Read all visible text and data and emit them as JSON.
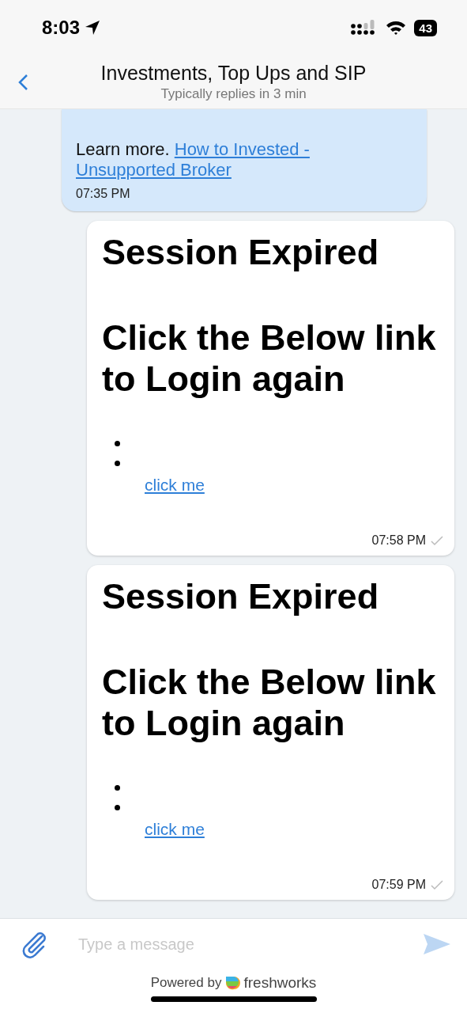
{
  "status_bar": {
    "time": "8:03",
    "battery": "43"
  },
  "header": {
    "title": "Investments, Top Ups and SIP",
    "subtitle": "Typically replies in 3 min"
  },
  "messages": [
    {
      "kind": "notice",
      "text": "Learn more.",
      "link_lines": [
        "How to Invested -",
        "Unsupported Broker"
      ],
      "time": "07:35 PM"
    },
    {
      "kind": "card",
      "heading": "Session Expired",
      "body": "Click the Below link to Login again",
      "link": "click me",
      "time": "07:58 PM",
      "delivered": true
    },
    {
      "kind": "card",
      "heading": "Session Expired",
      "body": "Click the Below link to Login again",
      "link": "click me",
      "time": "07:59 PM",
      "delivered": true
    }
  ],
  "composer": {
    "placeholder": "Type a message"
  },
  "footer": {
    "prefix": "Powered by",
    "brand": "freshworks"
  }
}
